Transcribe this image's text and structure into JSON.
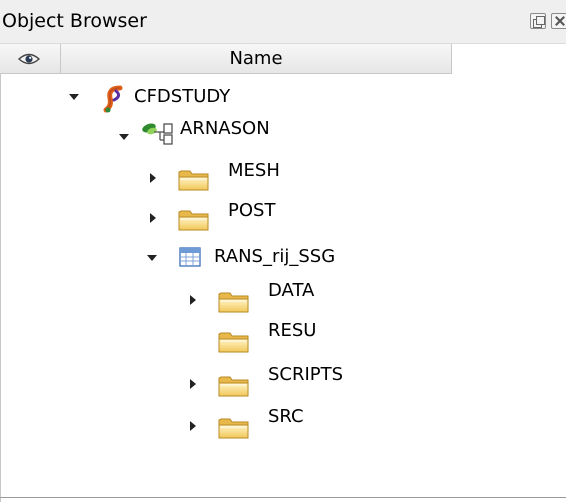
{
  "panel": {
    "title": "Object Browser"
  },
  "columns": {
    "visibility_icon": "eye-icon",
    "name_header": "Name"
  },
  "tree": {
    "root": {
      "label": "CFDSTUDY",
      "icon": "cfdstudy-icon",
      "expanded": true
    },
    "study": {
      "label": "ARNASON",
      "icon": "study-case-icon",
      "expanded": true
    },
    "mesh": {
      "label": "MESH",
      "icon": "folder-icon",
      "expanded": false
    },
    "post": {
      "label": "POST",
      "icon": "folder-icon",
      "expanded": false
    },
    "case": {
      "label": "RANS_rij_SSG",
      "icon": "table-icon",
      "expanded": true
    },
    "data": {
      "label": "DATA",
      "icon": "folder-icon",
      "expanded": false
    },
    "resu": {
      "label": "RESU",
      "icon": "folder-icon"
    },
    "scripts": {
      "label": "SCRIPTS",
      "icon": "folder-icon",
      "expanded": false
    },
    "src": {
      "label": "SRC",
      "icon": "folder-icon",
      "expanded": false
    }
  }
}
